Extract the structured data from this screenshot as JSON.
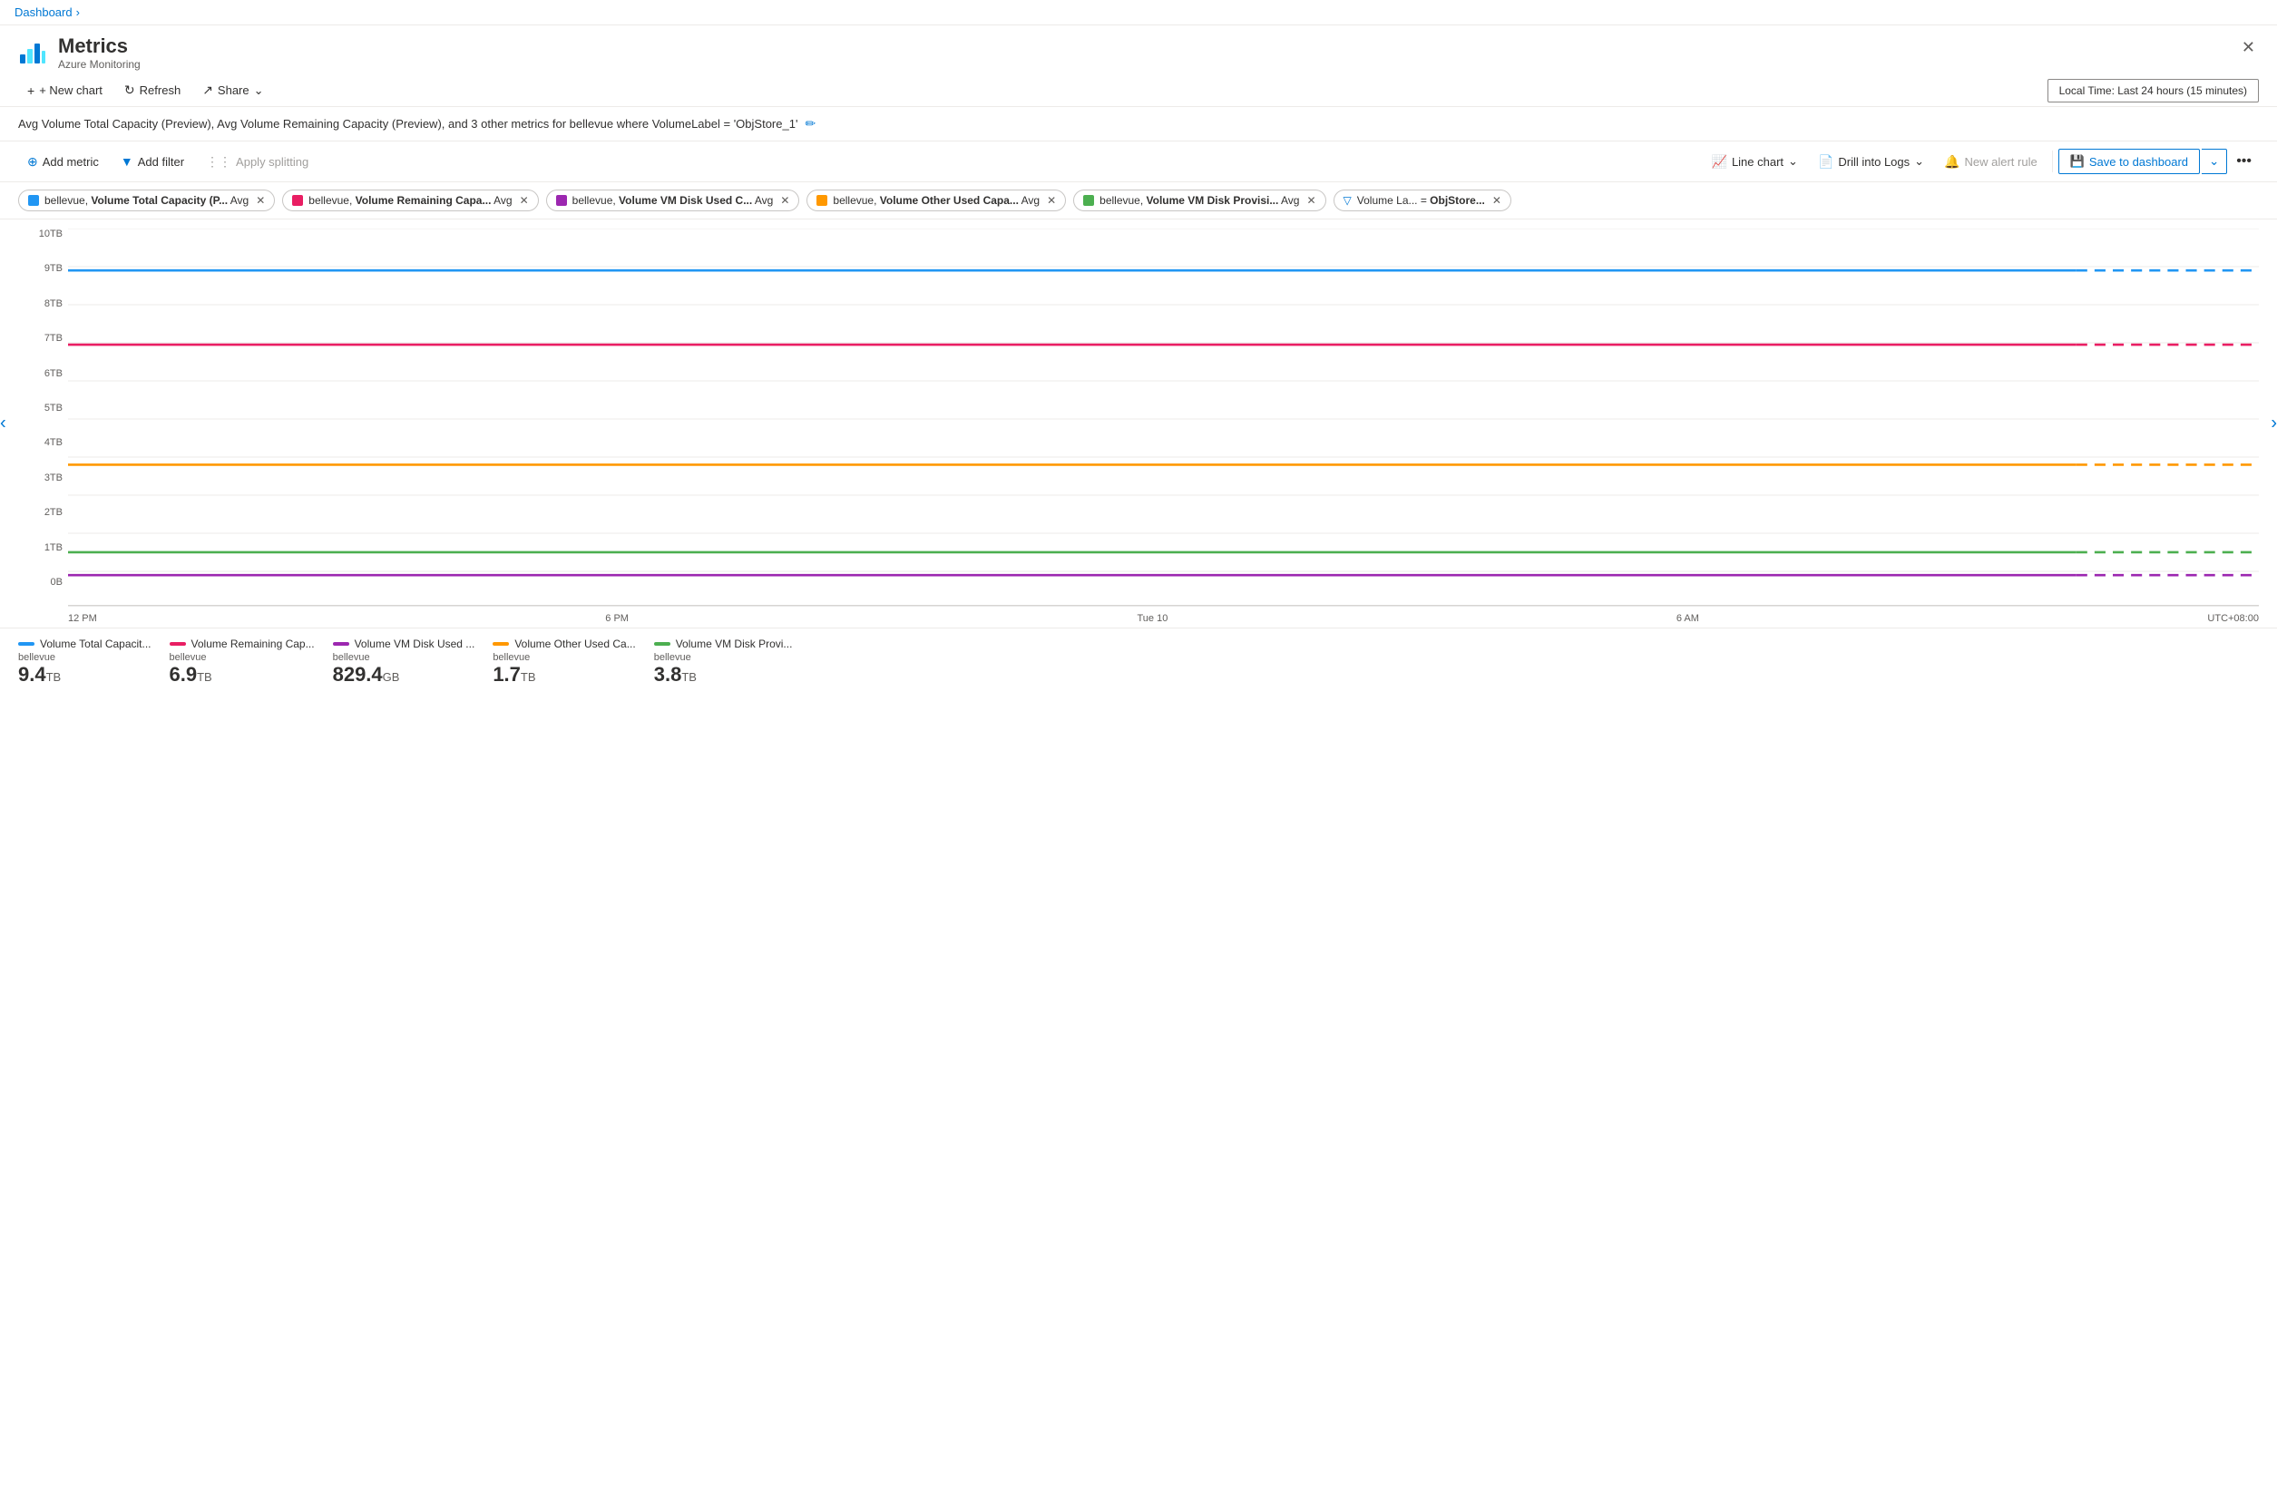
{
  "breadcrumb": {
    "label": "Dashboard",
    "chevron": "›"
  },
  "header": {
    "title": "Metrics",
    "subtitle": "Azure Monitoring",
    "close_label": "✕"
  },
  "toolbar": {
    "new_chart": "+ New chart",
    "refresh": "Refresh",
    "share": "Share",
    "time_picker": "Local Time: Last 24 hours (15 minutes)"
  },
  "chart_title": {
    "text": "Avg Volume Total Capacity (Preview), Avg Volume Remaining Capacity (Preview), and 3 other metrics for bellevue where VolumeLabel = 'ObjStore_1'"
  },
  "metrics_toolbar": {
    "add_metric": "Add metric",
    "add_filter": "Add filter",
    "apply_splitting": "Apply splitting",
    "line_chart": "Line chart",
    "drill_into_logs": "Drill into Logs",
    "new_alert_rule": "New alert rule",
    "save_to_dashboard": "Save to dashboard",
    "chevron_down": "⌄",
    "more": "···"
  },
  "pills": [
    {
      "id": "pill1",
      "color": "#2196F3",
      "text": "bellevue,",
      "bold": "Volume Total Capacity (P...",
      "agg": "Avg"
    },
    {
      "id": "pill2",
      "color": "#E91E63",
      "text": "bellevue,",
      "bold": "Volume Remaining Capa...",
      "agg": "Avg"
    },
    {
      "id": "pill3",
      "color": "#9C27B0",
      "text": "bellevue,",
      "bold": "Volume VM Disk Used C...",
      "agg": "Avg"
    },
    {
      "id": "pill4",
      "color": "#FF9800",
      "text": "bellevue,",
      "bold": "Volume Other Used Capa...",
      "agg": "Avg"
    },
    {
      "id": "pill5",
      "color": "#4CAF50",
      "text": "bellevue,",
      "bold": "Volume VM Disk Provisi...",
      "agg": "Avg"
    }
  ],
  "filter_pill": {
    "label": "Volume La...",
    "operator": "=",
    "value": "ObjStore..."
  },
  "chart": {
    "y_labels": [
      "10TB",
      "9TB",
      "8TB",
      "7TB",
      "6TB",
      "5TB",
      "4TB",
      "3TB",
      "2TB",
      "1TB",
      "0B"
    ],
    "x_labels": [
      "12 PM",
      "6 PM",
      "Tue 10",
      "6 AM",
      "UTC+08:00"
    ],
    "lines": [
      {
        "id": "volume_total",
        "color": "#2196F3",
        "y_pct": 89,
        "dashed": false
      },
      {
        "id": "volume_remaining",
        "color": "#E91E63",
        "y_pct": 69,
        "dashed": false
      },
      {
        "id": "volume_vm_disk_used",
        "color": "#9C27B0",
        "y_pct": 8,
        "dashed": false
      },
      {
        "id": "volume_other_used",
        "color": "#FF9800",
        "y_pct": 38,
        "dashed": false
      },
      {
        "id": "volume_vm_disk_prov",
        "color": "#4CAF50",
        "y_pct": 15,
        "dashed": false
      }
    ]
  },
  "legend": [
    {
      "id": "leg1",
      "color": "#2196F3",
      "name": "Volume Total Capacit...",
      "resource": "bellevue",
      "value": "9.4",
      "unit": "TB"
    },
    {
      "id": "leg2",
      "color": "#E91E63",
      "name": "Volume Remaining Cap...",
      "resource": "bellevue",
      "value": "6.9",
      "unit": "TB"
    },
    {
      "id": "leg3",
      "color": "#9C27B0",
      "name": "Volume VM Disk Used ...",
      "resource": "bellevue",
      "value": "829.4",
      "unit": "GB"
    },
    {
      "id": "leg4",
      "color": "#FF9800",
      "name": "Volume Other Used Ca...",
      "resource": "bellevue",
      "value": "1.7",
      "unit": "TB"
    },
    {
      "id": "leg5",
      "color": "#4CAF50",
      "name": "Volume VM Disk Provi...",
      "resource": "bellevue",
      "value": "3.8",
      "unit": "TB"
    }
  ]
}
